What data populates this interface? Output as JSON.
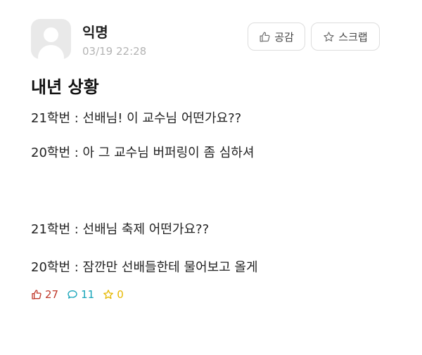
{
  "post": {
    "author": "익명",
    "date": "03/19 22:28",
    "title": "내년 상황",
    "lines": [
      "21학번 : 선배님! 이 교수님 어떤가요??",
      "20학번 : 아 그 교수님 버퍼링이 좀 심하셔",
      "21학번 : 선배님 축제 어떤가요??",
      "20학번 : 잠깐만 선배들한테 물어보고 올게"
    ]
  },
  "actions": {
    "like_label": "공감",
    "scrap_label": "스크랩"
  },
  "stats": {
    "likes": "27",
    "comments": "11",
    "scraps": "0"
  },
  "colors": {
    "like": "#c0392b",
    "comment": "#13a3b8",
    "scrap": "#e6b800",
    "date": "#b4b4b4"
  },
  "icons": {
    "like": "thumbs-up-icon",
    "scrap": "star-icon",
    "comment": "speech-bubble-icon",
    "avatar": "default-user-avatar"
  }
}
